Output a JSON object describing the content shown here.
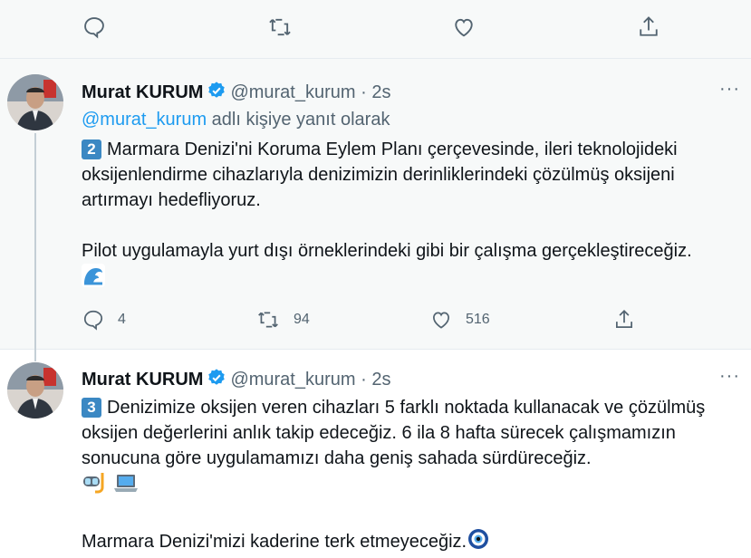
{
  "tweets": [
    {
      "author_name": "Murat KURUM",
      "handle": "@murat_kurum",
      "dot": "·",
      "time": "2s",
      "more": "···",
      "reply_prefix": "@murat_kurum",
      "reply_suffix": " adlı kişiye yanıt olarak",
      "number_badge": "2",
      "paragraph1": "Marmara Denizi'ni Koruma Eylem Planı çerçevesinde, ileri teknolojideki oksijenlendirme cihazlarıyla denizimizin derinliklerindeki çözülmüş oksijeni artırmayı hedefliyoruz.",
      "paragraph2": "Pilot uygulamayla yurt dışı örneklerindeki gibi bir çalışma gerçekleştireceğiz.",
      "emoji": "wave-emoji",
      "reply_count": "4",
      "retweet_count": "94",
      "like_count": "516"
    },
    {
      "author_name": "Murat KURUM",
      "handle": "@murat_kurum",
      "dot": "·",
      "time": "2s",
      "more": "···",
      "number_badge": "3",
      "paragraph1": "Denizimize oksijen veren cihazları 5 farklı noktada kullanacak ve çözülmüş oksijen değerlerini anlık takip edeceğiz. 6 ila 8 hafta sürecek çalışmamızın sonucuna göre uygulamamızı daha geniş sahada sürdüreceğiz.",
      "emojis": [
        "diving-mask-emoji",
        "laptop-emoji"
      ],
      "paragraph2": "Marmara Denizi'mizi kaderine terk etmeyeceğiz.",
      "end_emoji": "nazar-amulet-emoji"
    }
  ],
  "colors": {
    "accent": "#1d9bf0",
    "muted": "#536471",
    "badge": "#3b88c3"
  }
}
